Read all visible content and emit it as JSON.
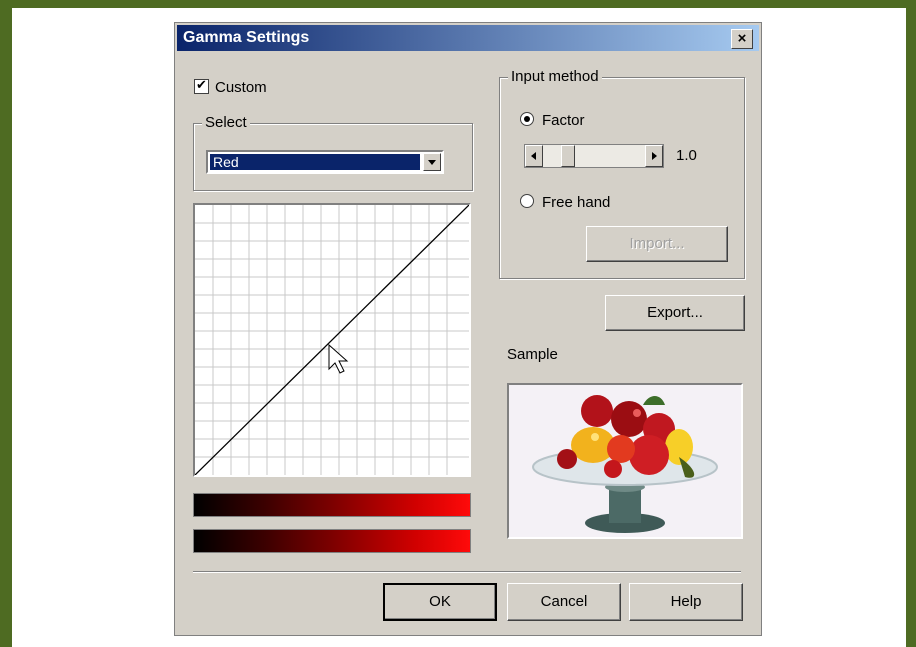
{
  "dialog": {
    "title": "Gamma Settings",
    "close_label": "×"
  },
  "custom": {
    "label": "Custom",
    "checked": true
  },
  "select": {
    "label": "Select",
    "value": "Red"
  },
  "input_method": {
    "label": "Input method",
    "factor_label": "Factor",
    "factor_value": "1.0",
    "factor_selected": true,
    "freehand_label": "Free hand",
    "import_label": "Import..."
  },
  "export_label": "Export...",
  "sample_label": "Sample",
  "buttons": {
    "ok": "OK",
    "cancel": "Cancel",
    "help": "Help"
  },
  "colors": {
    "frame": "#4e6b22",
    "dialog_bg": "#d4d0c8",
    "title_gradient_start": "#0a246a",
    "title_gradient_end": "#a6caf0",
    "gradient_end": "#ff0a0a"
  },
  "icons": {
    "close": "close-icon",
    "dropdown": "chevron-down-icon",
    "cursor": "arrow-cursor-icon"
  }
}
